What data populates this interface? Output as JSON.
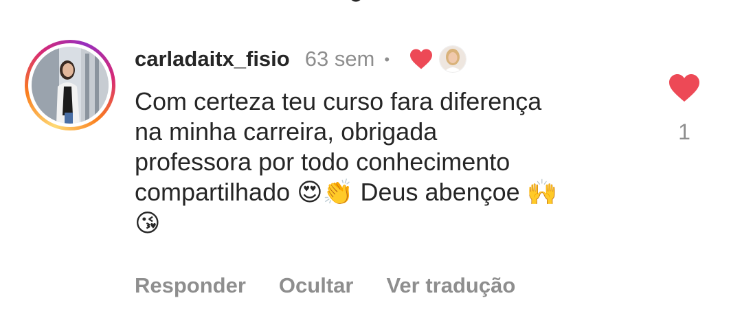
{
  "comment": {
    "username": "carladaitx_fisio",
    "time": "63 sem",
    "separator": "•",
    "text_line1": "Com certeza teu curso fara diferença",
    "text_line2": "na minha carreira, obrigada",
    "text_line3": "professora por todo conhecimento",
    "text_line4_a": "compartilhado ",
    "text_line4_b": "😍👏",
    "text_line4_c": " Deus abençoe ",
    "text_line4_d": "🙌",
    "text_line5": "😘",
    "liked_by_author": true,
    "like_count": "1",
    "like_color": "#ed4956"
  },
  "actions": {
    "reply": "Responder",
    "hide": "Ocultar",
    "translate": "Ver tradução"
  },
  "icons": {
    "comment_like": "heart-filled-icon",
    "author_like": "heart-filled-icon"
  },
  "colors": {
    "text": "#262626",
    "secondary": "#8e8e8e",
    "like": "#ed4956",
    "story_ring": [
      "#feda75",
      "#fa7e1e",
      "#d62976",
      "#962fbf"
    ]
  }
}
